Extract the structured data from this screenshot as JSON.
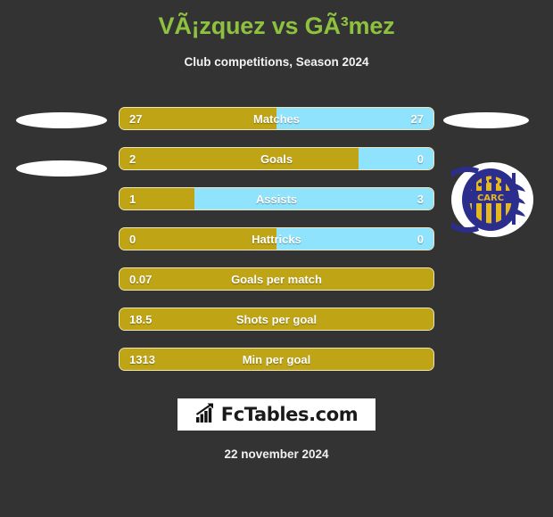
{
  "header": {
    "title": "VÃ¡zquez vs GÃ³mez",
    "subtitle": "Club competitions, Season 2024"
  },
  "colors": {
    "background": "#333333",
    "title_green": "#8FC140",
    "bar_gold": "#BFA415",
    "bar_blue": "#8FE3FC",
    "text_white": "#FFFFFF",
    "logo_background": "#FFFFFF",
    "crest_navy": "#2B2E8C",
    "crest_gold": "#E5B720"
  },
  "chart_data": {
    "type": "bar",
    "title": "VÃ¡zquez vs GÃ³mez",
    "subtitle": "Club competitions, Season 2024",
    "orientation": "horizontal-diverging",
    "series": [
      {
        "name": "VÃ¡zquez",
        "color": "#BFA415"
      },
      {
        "name": "GÃ³mez",
        "color": "#8FE3FC"
      }
    ],
    "categories": [
      "Matches",
      "Goals",
      "Assists",
      "Hattricks",
      "Goals per match",
      "Shots per goal",
      "Min per goal"
    ],
    "rows": [
      {
        "label": "Matches",
        "left_value": "27",
        "right_value": "27",
        "left_pct": 50,
        "two_sided": true
      },
      {
        "label": "Goals",
        "left_value": "2",
        "right_value": "0",
        "left_pct": 76,
        "two_sided": true
      },
      {
        "label": "Assists",
        "left_value": "1",
        "right_value": "3",
        "left_pct": 24,
        "two_sided": true
      },
      {
        "label": "Hattricks",
        "left_value": "0",
        "right_value": "0",
        "left_pct": 50,
        "two_sided": true
      },
      {
        "label": "Goals per match",
        "left_value": "0.07",
        "right_value": "",
        "left_pct": 100,
        "two_sided": false
      },
      {
        "label": "Shots per goal",
        "left_value": "18.5",
        "right_value": "",
        "left_pct": 100,
        "two_sided": false
      },
      {
        "label": "Min per goal",
        "left_value": "1313",
        "right_value": "",
        "left_pct": 100,
        "two_sided": false
      }
    ]
  },
  "crest": {
    "name": "rosario-central-crest",
    "text": "CARC"
  },
  "logo": {
    "text": "FcTables.com",
    "icon": "bar-chart-growth-icon"
  },
  "footer": {
    "date": "22 november 2024"
  }
}
